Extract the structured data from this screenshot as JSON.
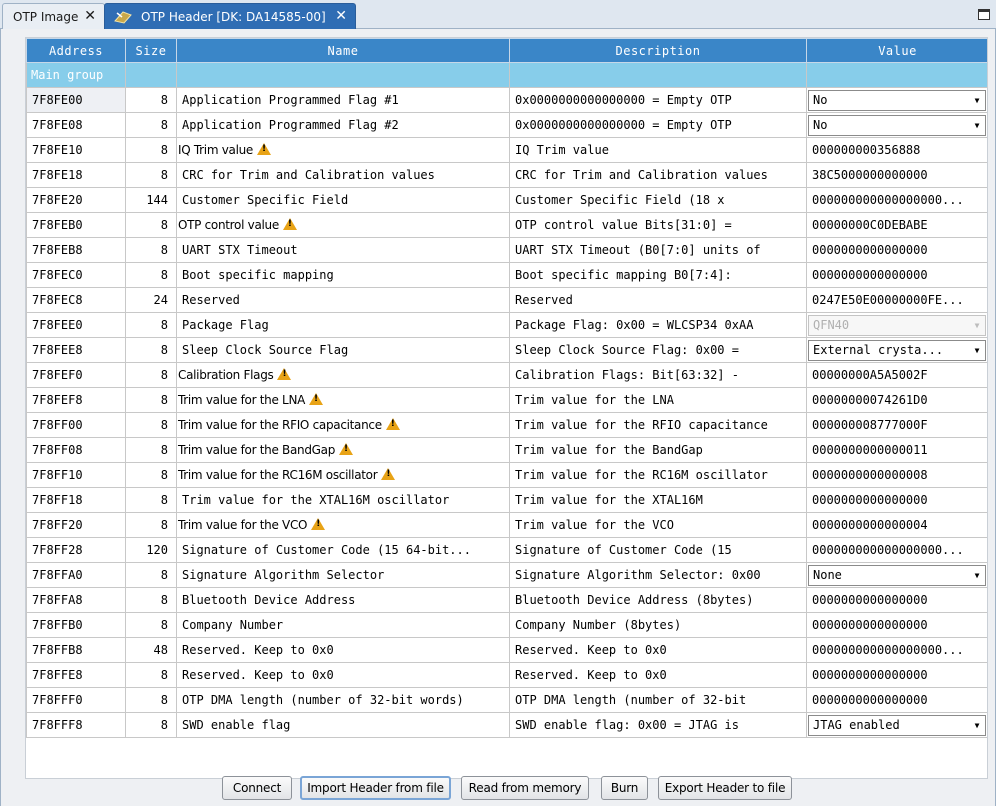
{
  "tabs": [
    {
      "label": "OTP Image",
      "active": false
    },
    {
      "label": "OTP Header [DK: DA14585-00]",
      "active": true
    }
  ],
  "table": {
    "columns": [
      "Address",
      "Size",
      "Name",
      "Description",
      "Value"
    ],
    "group": "Main group",
    "rows": [
      {
        "address": "7F8FE00",
        "size": "8",
        "name": "Application Programmed Flag #1",
        "description": "0x0000000000000000 = Empty OTP",
        "value": "No",
        "warn": false,
        "combo": true
      },
      {
        "address": "7F8FE08",
        "size": "8",
        "name": "Application Programmed Flag #2",
        "description": "0x0000000000000000 = Empty OTP",
        "value": "No",
        "warn": false,
        "combo": true
      },
      {
        "address": "7F8FE10",
        "size": "8",
        "name": "IQ Trim value",
        "description": "IQ Trim value",
        "value": "000000000356888",
        "warn": true
      },
      {
        "address": "7F8FE18",
        "size": "8",
        "name": "CRC for Trim and Calibration values",
        "description": "CRC for Trim and Calibration values",
        "value": "38C5000000000000",
        "warn": false
      },
      {
        "address": "7F8FE20",
        "size": "144",
        "name": "Customer Specific Field",
        "description": "Customer Specific Field (18 x",
        "value": "000000000000000000...",
        "warn": false
      },
      {
        "address": "7F8FEB0",
        "size": "8",
        "name": "OTP control value",
        "description": "OTP control value Bits[31:0] =",
        "value": "00000000C0DEBABE",
        "warn": true
      },
      {
        "address": "7F8FEB8",
        "size": "8",
        "name": "UART STX Timeout",
        "description": "UART STX Timeout (B0[7:0] units of",
        "value": "0000000000000000",
        "warn": false
      },
      {
        "address": "7F8FEC0",
        "size": "8",
        "name": "Boot specific mapping",
        "description": "Boot specific mapping B0[7:4]:",
        "value": "0000000000000000",
        "warn": false
      },
      {
        "address": "7F8FEC8",
        "size": "24",
        "name": "Reserved",
        "description": "Reserved",
        "value": "0247E50E00000000FE...",
        "warn": false
      },
      {
        "address": "7F8FEE0",
        "size": "8",
        "name": "Package Flag",
        "description": "Package Flag: 0x00 = WLCSP34 0xAA",
        "value": "QFN40",
        "warn": false,
        "combo": true,
        "disabled": true
      },
      {
        "address": "7F8FEE8",
        "size": "8",
        "name": "Sleep Clock Source Flag",
        "description": "Sleep Clock Source Flag: 0x00 =",
        "value": "External crysta...",
        "warn": false,
        "combo": true
      },
      {
        "address": "7F8FEF0",
        "size": "8",
        "name": "Calibration Flags",
        "description": "Calibration Flags: Bit[63:32] -",
        "value": "00000000A5A5002F",
        "warn": true
      },
      {
        "address": "7F8FEF8",
        "size": "8",
        "name": "Trim value for the LNA",
        "description": "Trim value for the LNA",
        "value": "00000000074261D0",
        "warn": true
      },
      {
        "address": "7F8FF00",
        "size": "8",
        "name": "Trim value for the RFIO capacitance",
        "description": "Trim value for the RFIO capacitance",
        "value": "000000008777000F",
        "warn": true
      },
      {
        "address": "7F8FF08",
        "size": "8",
        "name": "Trim value for the BandGap",
        "description": "Trim value for the BandGap",
        "value": "0000000000000011",
        "warn": true
      },
      {
        "address": "7F8FF10",
        "size": "8",
        "name": "Trim value for the RC16M oscillator",
        "description": "Trim value for the RC16M oscillator",
        "value": "0000000000000008",
        "warn": true
      },
      {
        "address": "7F8FF18",
        "size": "8",
        "name": "Trim value for the XTAL16M oscillator",
        "description": "Trim value for the XTAL16M",
        "value": "0000000000000000",
        "warn": false
      },
      {
        "address": "7F8FF20",
        "size": "8",
        "name": "Trim value for the VCO",
        "description": "Trim value for the VCO",
        "value": "0000000000000004",
        "warn": true
      },
      {
        "address": "7F8FF28",
        "size": "120",
        "name": "Signature of Customer Code (15 64-bit...",
        "description": "Signature of Customer Code (15",
        "value": "000000000000000000...",
        "warn": false
      },
      {
        "address": "7F8FFA0",
        "size": "8",
        "name": "Signature Algorithm Selector",
        "description": "Signature Algorithm Selector: 0x00",
        "value": "None",
        "warn": false,
        "combo": true
      },
      {
        "address": "7F8FFA8",
        "size": "8",
        "name": "Bluetooth Device Address",
        "description": "Bluetooth Device Address (8bytes)",
        "value": "0000000000000000",
        "warn": false
      },
      {
        "address": "7F8FFB0",
        "size": "8",
        "name": "Company Number",
        "description": "Company Number (8bytes)",
        "value": "0000000000000000",
        "warn": false
      },
      {
        "address": "7F8FFB8",
        "size": "48",
        "name": "Reserved. Keep to 0x0",
        "description": "Reserved. Keep to 0x0",
        "value": "000000000000000000...",
        "warn": false
      },
      {
        "address": "7F8FFE8",
        "size": "8",
        "name": "Reserved. Keep to 0x0",
        "description": "Reserved. Keep to 0x0",
        "value": "0000000000000000",
        "warn": false
      },
      {
        "address": "7F8FFF0",
        "size": "8",
        "name": "OTP DMA length (number of 32-bit words)",
        "description": "OTP DMA length (number of 32-bit",
        "value": "0000000000000000",
        "warn": false
      },
      {
        "address": "7F8FFF8",
        "size": "8",
        "name": "SWD enable flag",
        "description": "SWD enable flag: 0x00 = JTAG is",
        "value": "JTAG enabled",
        "warn": false,
        "combo": true
      }
    ]
  },
  "buttons": {
    "connect": "Connect",
    "import_header": "Import Header from file",
    "read_memory": "Read from memory",
    "burn": "Burn",
    "export_header": "Export Header to file"
  },
  "colors": {
    "header_bg": "#3a86c8",
    "group_bg": "#87cdea",
    "active_tab": "#2f6db4",
    "warning": "#e8a316"
  }
}
